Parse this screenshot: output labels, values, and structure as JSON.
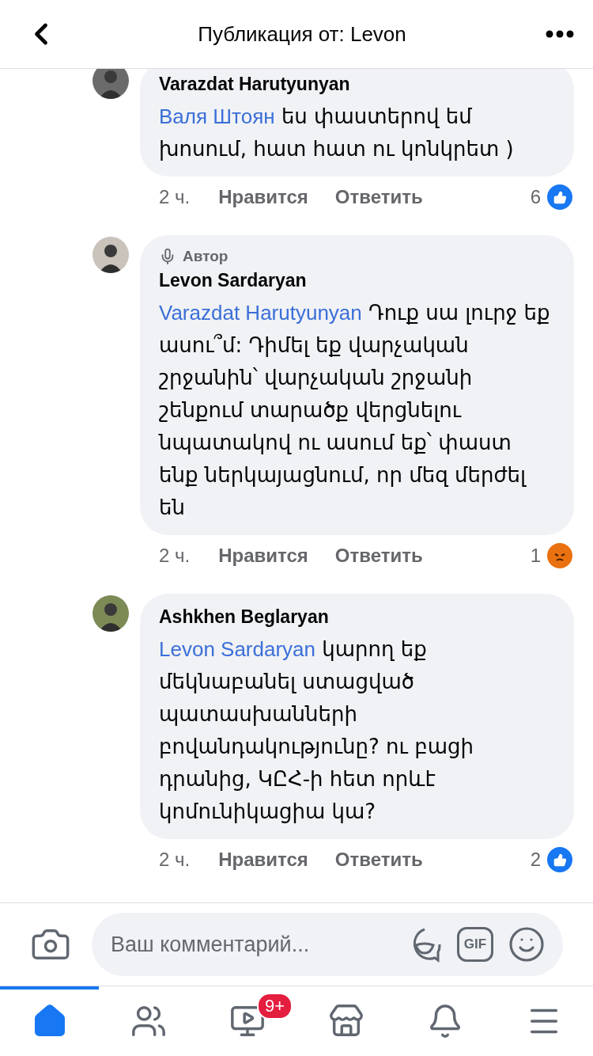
{
  "header": {
    "title": "Публикация от: Levon"
  },
  "comments": [
    {
      "author": "Varazdat Harutyunyan",
      "mention": "Валя Штоян",
      "text": "ես փաստերով եմ խոսում, հատ հատ ու կոնկրետ )",
      "time": "2 ч.",
      "like": "Нравится",
      "reply": "Ответить",
      "reaction": {
        "kind": "like",
        "count": "6"
      }
    },
    {
      "author": "Levon Sardaryan",
      "author_badge": "Автор",
      "mention": "Varazdat Harutyunyan",
      "text": "Դուք սա լուրջ եք ասու՞մ: Դիմել եք վարչական շրջանին՝ վարչական շրջանի շենքում տարածք վերցնելու նպատակով ու ասում եք՝ փաստ ենք ներկայացնում, որ մեզ մերժել են",
      "time": "2 ч.",
      "like": "Нравится",
      "reply": "Ответить",
      "reaction": {
        "kind": "angry",
        "count": "1"
      }
    },
    {
      "author": "Ashkhen Beglaryan",
      "mention": "Levon Sardaryan",
      "text": "կարող եք մեկնաբանել ստացված պատասխանների բովանդակությունը? ու բացի դրանից, ԿԸՀ-ի հետ որևէ կոմունիկացիա կա?",
      "time": "2 ч.",
      "like": "Нравится",
      "reply": "Ответить",
      "reaction": {
        "kind": "like",
        "count": "2"
      }
    }
  ],
  "composer": {
    "placeholder": "Ваш комментарий...",
    "gif": "GIF"
  },
  "tabs": [
    {
      "kind": "home",
      "selected": true
    },
    {
      "kind": "friends",
      "selected": false
    },
    {
      "kind": "watch",
      "selected": false,
      "badge": "9+"
    },
    {
      "kind": "marketplace",
      "selected": false
    },
    {
      "kind": "notifications",
      "selected": false
    },
    {
      "kind": "menu",
      "selected": false
    }
  ]
}
